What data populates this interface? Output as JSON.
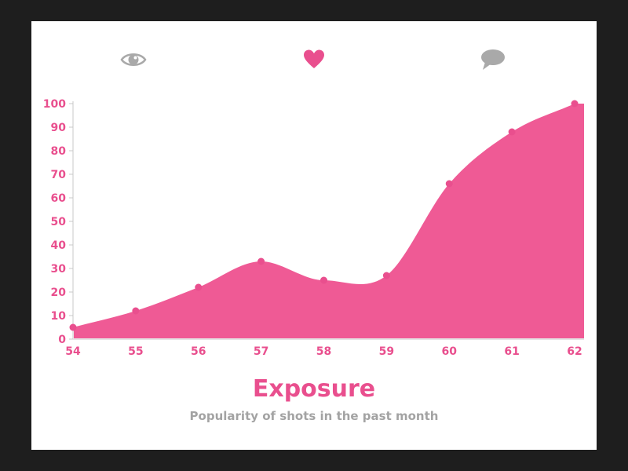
{
  "icons": {
    "views": "eye-icon",
    "likes": "heart-icon",
    "comments": "comment-icon"
  },
  "colors": {
    "accent": "#e94f8e",
    "area": "#ef5a95",
    "icon_gray": "#a9a9a9",
    "text_gray": "#a3a3a3",
    "background": "#1e1e1e"
  },
  "chart_data": {
    "type": "area",
    "title": "Exposure",
    "subtitle": "Popularity of shots in the past month",
    "x": [
      54,
      55,
      56,
      57,
      58,
      59,
      60,
      61,
      62
    ],
    "values": [
      5,
      12,
      22,
      33,
      25,
      27,
      66,
      88,
      100
    ],
    "xlim": [
      54,
      62
    ],
    "ylim": [
      0,
      100
    ],
    "yticks": [
      0,
      10,
      20,
      30,
      40,
      50,
      60,
      70,
      80,
      90,
      100
    ],
    "grid": false,
    "legend": "none"
  }
}
